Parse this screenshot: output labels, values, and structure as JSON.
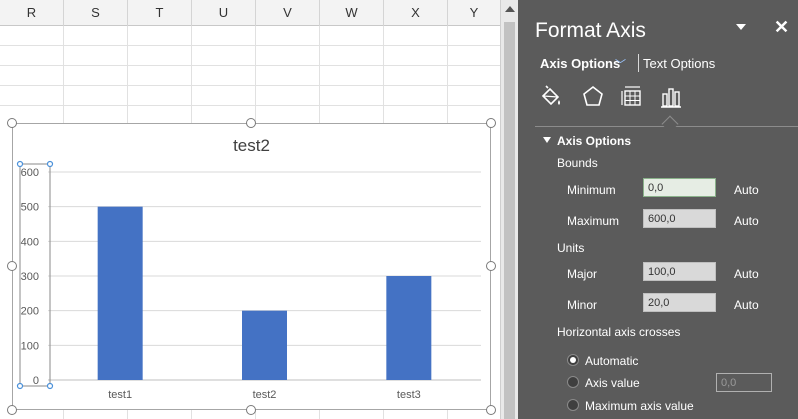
{
  "spreadsheet": {
    "columns": [
      "R",
      "S",
      "T",
      "U",
      "V",
      "W",
      "X",
      "Y"
    ]
  },
  "chart_data": {
    "type": "bar",
    "title": "test2",
    "categories": [
      "test1",
      "test2",
      "test3"
    ],
    "values": [
      500,
      200,
      300
    ],
    "ylim": [
      0,
      600
    ],
    "yticks": [
      0,
      100,
      200,
      300,
      400,
      500,
      600
    ],
    "bar_color": "#4472c4",
    "grid": true
  },
  "format_pane": {
    "title": "Format Axis",
    "close_glyph": "✕",
    "tabs": {
      "axis_options": "Axis Options",
      "text_options": "Text Options"
    },
    "category_icons": [
      "fill-line-icon",
      "effects-icon",
      "size-properties-icon",
      "axis-options-icon"
    ],
    "section_title": "Axis Options",
    "bounds_label": "Bounds",
    "minimum_label": "Minimum",
    "minimum_value": "0,0",
    "maximum_label": "Maximum",
    "maximum_value": "600,0",
    "units_label": "Units",
    "major_label": "Major",
    "major_value": "100,0",
    "minor_label": "Minor",
    "minor_value": "20,0",
    "auto_label": "Auto",
    "crosses_label": "Horizontal axis crosses",
    "radio_automatic": "Automatic",
    "radio_axis_value": "Axis value",
    "axis_value_placeholder": "0,0",
    "radio_maximum": "Maximum axis value",
    "accent_color": "#4472c4"
  }
}
